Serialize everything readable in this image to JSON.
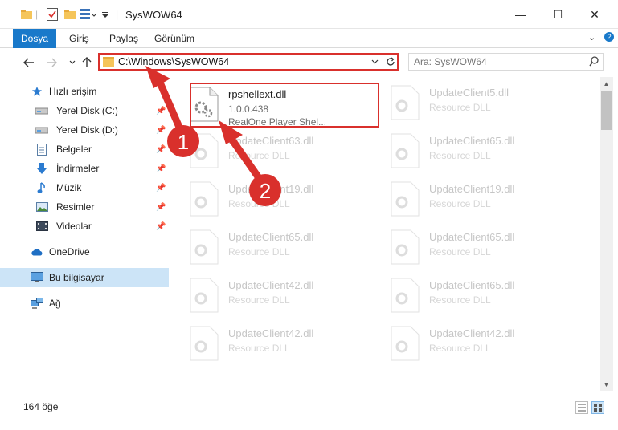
{
  "window": {
    "title": "SysWOW64",
    "minimize_label": "—",
    "maximize_label": "☐",
    "close_label": "✕"
  },
  "ribbon": {
    "tabs": [
      "Dosya",
      "Giriş",
      "Paylaş",
      "Görünüm"
    ],
    "expand_label": "⌄",
    "help_label": "?"
  },
  "address_bar": {
    "path": "C:\\Windows\\SysWOW64"
  },
  "search": {
    "placeholder": "Ara: SysWOW64"
  },
  "navigation": {
    "quick_access": "Hızlı erişim",
    "items": [
      {
        "label": "Yerel Disk (C:)",
        "icon": "drive-icon"
      },
      {
        "label": "Yerel Disk (D:)",
        "icon": "drive-icon"
      },
      {
        "label": "Belgeler",
        "icon": "documents-icon"
      },
      {
        "label": "İndirmeler",
        "icon": "downloads-icon"
      },
      {
        "label": "Müzik",
        "icon": "music-icon"
      },
      {
        "label": "Resimler",
        "icon": "pictures-icon"
      },
      {
        "label": "Videolar",
        "icon": "videos-icon"
      }
    ],
    "onedrive": "OneDrive",
    "this_pc": "Bu bilgisayar",
    "network": "Ağ"
  },
  "files": {
    "selected": {
      "name": "rpshellext.dll",
      "version": "1.0.0.438",
      "description": "RealOne Player Shel..."
    },
    "ghost": [
      {
        "name": "UpdateClient5.dll",
        "desc": "Resource DLL"
      },
      {
        "name": "UpdateClient63.dll",
        "desc": "Resource DLL"
      },
      {
        "name": "UpdateClient65.dll",
        "desc": "Resource DLL"
      },
      {
        "name": "UpdateClient19.dll",
        "desc": "Resource DLL"
      },
      {
        "name": "UpdateClient19.dll",
        "desc": "Resource DLL"
      },
      {
        "name": "UpdateClient65.dll",
        "desc": "Resource DLL"
      },
      {
        "name": "UpdateClient65.dll",
        "desc": "Resource DLL"
      },
      {
        "name": "UpdateClient42.dll",
        "desc": "Resource DLL"
      },
      {
        "name": "UpdateClient65.dll",
        "desc": "Resource DLL"
      },
      {
        "name": "UpdateClient42.dll",
        "desc": "Resource DLL"
      },
      {
        "name": "UpdateClient42.dll",
        "desc": "Resource DLL"
      }
    ]
  },
  "annotations": {
    "step1": "1",
    "step2": "2",
    "color": "#d9302c"
  },
  "status": {
    "item_count": "164 öğe"
  }
}
